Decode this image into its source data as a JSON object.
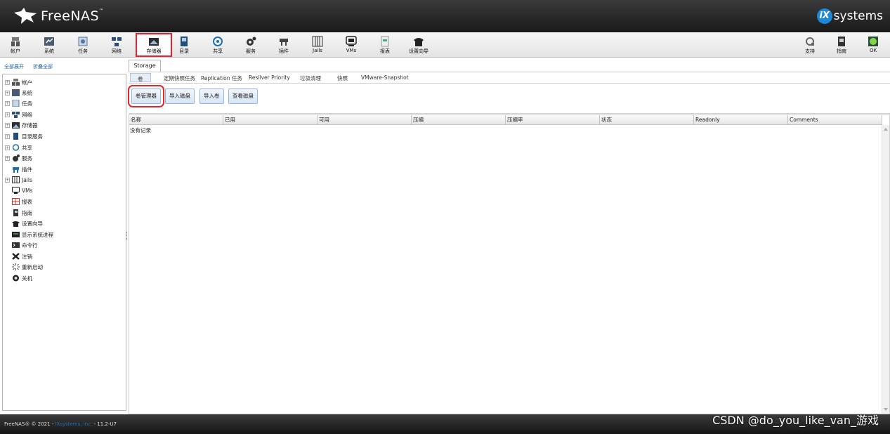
{
  "header": {
    "logo_text": "FreeNAS",
    "trademark": "™",
    "vendor_mark": "iX",
    "vendor_text": "systems"
  },
  "toolbar": {
    "items": [
      {
        "label": "帐户",
        "icon": "users-icon"
      },
      {
        "label": "系统",
        "icon": "system-icon"
      },
      {
        "label": "任务",
        "icon": "tasks-icon"
      },
      {
        "label": "网络",
        "icon": "network-icon"
      },
      {
        "label": "存储器",
        "icon": "storage-icon",
        "active": true
      },
      {
        "label": "目录",
        "icon": "directory-icon"
      },
      {
        "label": "共享",
        "icon": "sharing-icon"
      },
      {
        "label": "服务",
        "icon": "services-icon"
      },
      {
        "label": "插件",
        "icon": "plugins-icon"
      },
      {
        "label": "Jails",
        "icon": "jails-icon"
      },
      {
        "label": "VMs",
        "icon": "vms-icon"
      },
      {
        "label": "报表",
        "icon": "reports-icon"
      },
      {
        "label": "设置向导",
        "icon": "wizard-icon"
      }
    ],
    "right_items": [
      {
        "label": "支持",
        "icon": "support-icon"
      },
      {
        "label": "指南",
        "icon": "guide-icon"
      },
      {
        "label": "OK",
        "icon": "alert-ok-icon"
      }
    ]
  },
  "sidebar": {
    "expand_all": "全部展开",
    "collapse_all": "折叠全部",
    "items": [
      {
        "label": "帐户",
        "expandable": true
      },
      {
        "label": "系统",
        "expandable": true
      },
      {
        "label": "任务",
        "expandable": true
      },
      {
        "label": "网络",
        "expandable": true
      },
      {
        "label": "存储器",
        "expandable": true
      },
      {
        "label": "目录服务",
        "expandable": true
      },
      {
        "label": "共享",
        "expandable": true
      },
      {
        "label": "服务",
        "expandable": true
      },
      {
        "label": "插件",
        "expandable": false
      },
      {
        "label": "Jails",
        "expandable": true
      },
      {
        "label": "VMs",
        "expandable": false
      },
      {
        "label": "报表",
        "expandable": false
      },
      {
        "label": "指南",
        "expandable": false
      },
      {
        "label": "设置向导",
        "expandable": false
      },
      {
        "label": "显示系统进程",
        "expandable": false
      },
      {
        "label": "命令行",
        "expandable": false
      },
      {
        "label": "注销",
        "expandable": false
      },
      {
        "label": "重新启动",
        "expandable": false
      },
      {
        "label": "关机",
        "expandable": false
      }
    ]
  },
  "main": {
    "tab": "Storage",
    "subtabs": [
      "卷",
      "定期快照任务",
      "Replication 任务",
      "Resilver Priority",
      "垃圾清理",
      "快照",
      "VMware-Snapshot"
    ],
    "buttons": [
      "卷管理器",
      "导入磁盘",
      "导入卷",
      "查看磁盘"
    ],
    "columns": [
      "名称",
      "已用",
      "可用",
      "压缩",
      "压缩率",
      "状态",
      "Readonly",
      "Comments"
    ],
    "empty_text": "没有记录"
  },
  "footer": {
    "prefix": "FreeNAS® © 2021 - ",
    "vendor": "iXsystems, Inc.",
    "version": " - 11.2-U7"
  },
  "watermark": "CSDN @do_you_like_van_游戏",
  "colors": {
    "highlight": "#e8232b",
    "link": "#1f5fa8",
    "header_bg": "#2a2a2a"
  }
}
